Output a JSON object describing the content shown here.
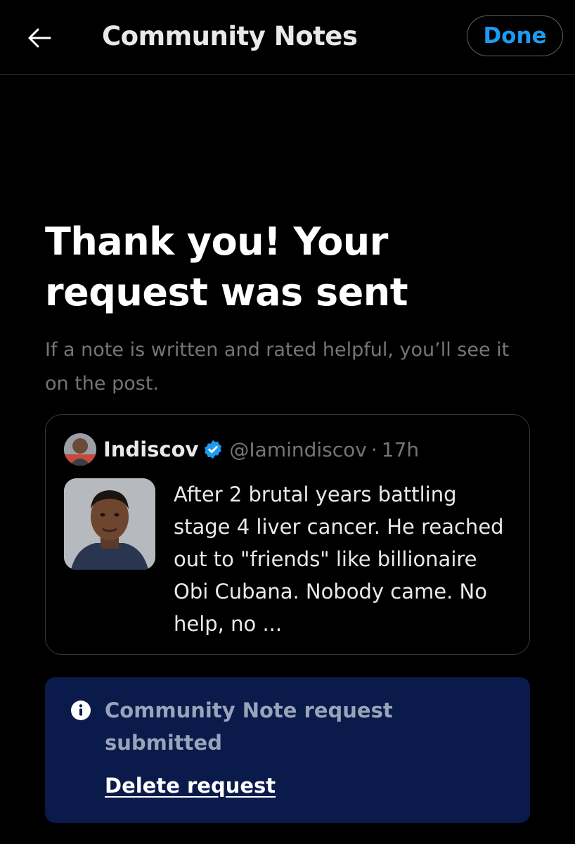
{
  "header": {
    "title": "Community Notes",
    "back_icon": "arrow-left-icon",
    "done_label": "Done"
  },
  "confirmation": {
    "headline": "Thank you! Your request was sent",
    "subtext": "If a note is written and rated helpful, you’ll see it on the post."
  },
  "post": {
    "author_name": "Indiscov",
    "verified_icon": "verified-badge-icon",
    "handle": "@Iamindiscov",
    "separator": "·",
    "time": "17h",
    "text": "After 2 brutal years battling stage 4 liver cancer. He reached out to \"friends\" like billionaire Obi Cubana. Nobody came. No help, no ..."
  },
  "note_status": {
    "icon": "info-icon",
    "title": "Community Note request submitted",
    "delete_label": "Delete request"
  },
  "colors": {
    "background": "#000000",
    "accent": "#1d9bf0",
    "note_box": "#0a1a4a",
    "muted_text": "#71767b"
  }
}
